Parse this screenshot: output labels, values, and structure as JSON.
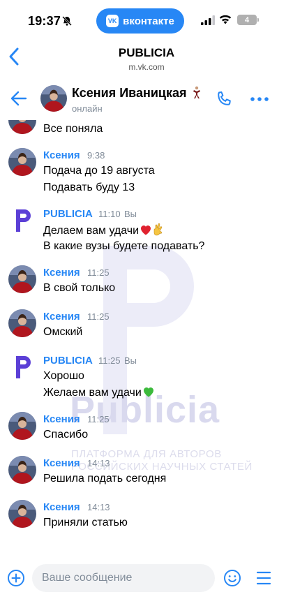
{
  "status_bar": {
    "time": "19:37",
    "vk_pill_label": "вконтакте",
    "vk_logo_text": "VK",
    "battery": "4"
  },
  "browser": {
    "title": "PUBLICIA",
    "url": "m.vk.com"
  },
  "chat": {
    "name": "Ксения Иваницкая",
    "status": "онлайн"
  },
  "messages": [
    {
      "author": "",
      "time": "",
      "self": "",
      "lines": [
        "Все поняла"
      ]
    },
    {
      "author": "Ксения",
      "time": "9:38",
      "self": "",
      "lines": [
        "Подача до 19 августа",
        "Подавать буду 13"
      ]
    },
    {
      "author": "PUBLICIA",
      "time": "11:10",
      "self": "Вы",
      "lines": [
        "Делаем вам удачи",
        "В какие вузы будете подавать?"
      ]
    },
    {
      "author": "Ксения",
      "time": "11:25",
      "self": "",
      "lines": [
        "В свой только"
      ]
    },
    {
      "author": "Ксения",
      "time": "11:25",
      "self": "",
      "lines": [
        "Омский"
      ]
    },
    {
      "author": "PUBLICIA",
      "time": "11:25",
      "self": "Вы",
      "lines": [
        "Хорошо",
        "Желаем вам удачи"
      ]
    },
    {
      "author": "Ксения",
      "time": "11:25",
      "self": "",
      "lines": [
        "Спасибо"
      ]
    },
    {
      "author": "Ксения",
      "time": "14:13",
      "self": "",
      "lines": [
        "Решила подать сегодня"
      ]
    },
    {
      "author": "Ксения",
      "time": "14:13",
      "self": "",
      "lines": [
        "Приняли статью"
      ]
    }
  ],
  "watermark": {
    "word": "Publicia",
    "line1": "ПЛАТФОРМА ДЛЯ АВТОРОВ",
    "line2": "РОССИЙСКИХ НАУЧНЫХ СТАТЕЙ"
  },
  "composer": {
    "placeholder": "Ваше сообщение"
  },
  "colors": {
    "accent": "#2787f5",
    "brand_purple": "#5b3fd6",
    "meta_gray": "#818c99"
  },
  "icons": [
    "back-chevron-icon",
    "arrow-back-icon",
    "phone-icon",
    "more-icon",
    "plus-icon",
    "smile-icon",
    "menu-icon",
    "heart-emoji",
    "crossed-fingers-emoji",
    "green-heart-emoji"
  ]
}
